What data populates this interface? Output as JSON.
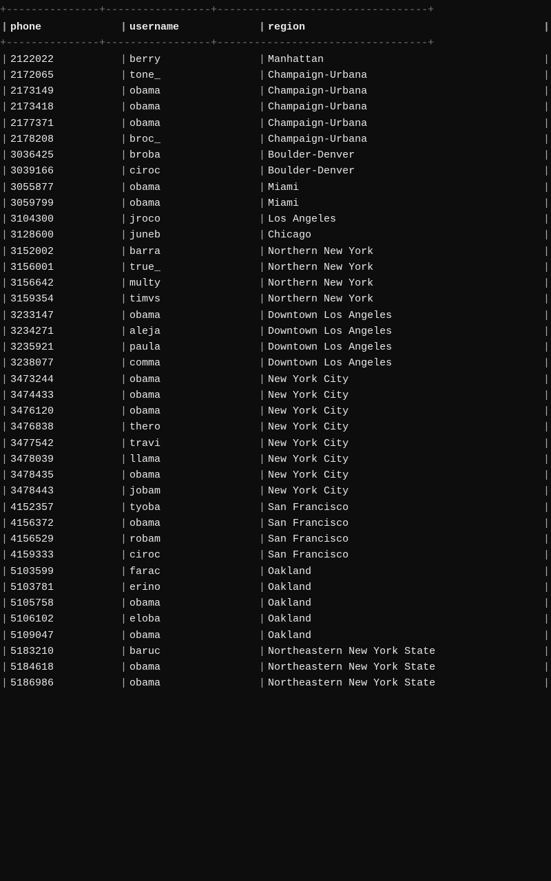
{
  "table": {
    "border_top": "+--------------+--------------+----------------------------------+",
    "border_mid": "+--------------+--------------+----------------------------------+",
    "headers": {
      "phone": "phone",
      "username": "username",
      "region": "region"
    },
    "rows": [
      {
        "phone": "2122022",
        "phone_blur": "    ",
        "username": "berry",
        "username_blur": "          ",
        "region": "Manhattan"
      },
      {
        "phone": "2172065",
        "phone_blur": "    ",
        "username": "tone_",
        "username_blur": "         ",
        "region": "Champaign-Urbana"
      },
      {
        "phone": "2173149",
        "phone_blur": "    ",
        "username": "obama",
        "username_blur": "         ",
        "region": "Champaign-Urbana"
      },
      {
        "phone": "2173418",
        "phone_blur": "    ",
        "username": "obama",
        "username_blur": "         ",
        "region": "Champaign-Urbana"
      },
      {
        "phone": "2177371",
        "phone_blur": "    ",
        "username": "obama",
        "username_blur": "              ",
        "region": "Champaign-Urbana"
      },
      {
        "phone": "2178208",
        "phone_blur": "    ",
        "username": "broc_",
        "username_blur": "         ",
        "region": "Champaign-Urbana"
      },
      {
        "phone": "3036425",
        "phone_blur": "    ",
        "username": "broba",
        "username_blur": "         ",
        "region": "Boulder-Denver"
      },
      {
        "phone": "3039166",
        "phone_blur": "    ",
        "username": "ciroc",
        "username_blur": "         ",
        "region": "Boulder-Denver"
      },
      {
        "phone": "3055877",
        "phone_blur": "    ",
        "username": "obama",
        "username_blur": "         ",
        "region": "Miami"
      },
      {
        "phone": "3059799",
        "phone_blur": "    ",
        "username": "obama",
        "username_blur": "         ",
        "region": "Miami"
      },
      {
        "phone": "3104300",
        "phone_blur": "    ",
        "username": "jroco",
        "username_blur": "         ",
        "region": "Los Angeles"
      },
      {
        "phone": "3128600",
        "phone_blur": "    ",
        "username": "juneb",
        "username_blur": "         ",
        "region": "Chicago"
      },
      {
        "phone": "3152002",
        "phone_blur": "    ",
        "username": "barra",
        "username_blur": "         ",
        "region": "Northern New York"
      },
      {
        "phone": "3156001",
        "phone_blur": "    ",
        "username": "true_",
        "username_blur": "         ",
        "region": "Northern New York"
      },
      {
        "phone": "3156642",
        "phone_blur": "    ",
        "username": "multy",
        "username_blur": "              ",
        "region": "Northern New York"
      },
      {
        "phone": "3159354",
        "phone_blur": "    ",
        "username": "timvs",
        "username_blur": "         ",
        "region": "Northern New York"
      },
      {
        "phone": "3233147",
        "phone_blur": "    ",
        "username": "obama",
        "username_blur": "         ",
        "region": "Downtown Los Angeles"
      },
      {
        "phone": "3234271",
        "phone_blur": "    ",
        "username": "aleja",
        "username_blur": "         ",
        "region": "Downtown Los Angeles"
      },
      {
        "phone": "3235921",
        "phone_blur": "    ",
        "username": "paula",
        "username_blur": "         ",
        "region": "Downtown Los Angeles"
      },
      {
        "phone": "3238077",
        "phone_blur": "    ",
        "username": "comma",
        "username_blur": "              ",
        "region": "Downtown Los Angeles"
      },
      {
        "phone": "3473244",
        "phone_blur": "    ",
        "username": "obama",
        "username_blur": "        ",
        "region": "New York City"
      },
      {
        "phone": "3474433",
        "phone_blur": "    ",
        "username": "obama",
        "username_blur": "         ",
        "region": "New York City"
      },
      {
        "phone": "3476120",
        "phone_blur": "    ",
        "username": "obama",
        "username_blur": "         ",
        "region": "New York City"
      },
      {
        "phone": "3476838",
        "phone_blur": "    ",
        "username": "thero",
        "username_blur": "         ",
        "region": "New York City"
      },
      {
        "phone": "3477542",
        "phone_blur": "    ",
        "username": "travi",
        "username_blur": "         ",
        "region": "New York City"
      },
      {
        "phone": "3478039",
        "phone_blur": "    ",
        "username": "llama",
        "username_blur": "         ",
        "region": "New York City"
      },
      {
        "phone": "3478435",
        "phone_blur": "    ",
        "username": "obama",
        "username_blur": "              ",
        "region": "New York City"
      },
      {
        "phone": "3478443",
        "phone_blur": "    ",
        "username": "jobam",
        "username_blur": "         ",
        "region": "New York City"
      },
      {
        "phone": "4152357",
        "phone_blur": "    ",
        "username": "tyoba",
        "username_blur": "         ",
        "region": "San Francisco"
      },
      {
        "phone": "4156372",
        "phone_blur": "    ",
        "username": "obama",
        "username_blur": "              ",
        "region": "San Francisco"
      },
      {
        "phone": "4156529",
        "phone_blur": "    ",
        "username": "robam",
        "username_blur": "         ",
        "region": "San Francisco"
      },
      {
        "phone": "4159333",
        "phone_blur": "    ",
        "username": "ciroc",
        "username_blur": "         ",
        "region": "San Francisco"
      },
      {
        "phone": "5103599",
        "phone_blur": "    ",
        "username": "farac",
        "username_blur": "         ",
        "region": "Oakland"
      },
      {
        "phone": "5103781",
        "phone_blur": "    ",
        "username": "erino",
        "username_blur": "         ",
        "region": "Oakland"
      },
      {
        "phone": "5105758",
        "phone_blur": "    ",
        "username": "obama",
        "username_blur": "         ",
        "region": "Oakland"
      },
      {
        "phone": "5106102",
        "phone_blur": "    ",
        "username": "eloba",
        "username_blur": "         ",
        "region": "Oakland"
      },
      {
        "phone": "5109047",
        "phone_blur": "    ",
        "username": "obama",
        "username_blur": "         ",
        "region": "Oakland"
      },
      {
        "phone": "5183210",
        "phone_blur": "    ",
        "username": "baruc",
        "username_blur": "         ",
        "region": "Northeastern New York State"
      },
      {
        "phone": "5184618",
        "phone_blur": "    ",
        "username": "obama",
        "username_blur": "         ",
        "region": "Northeastern New York State"
      },
      {
        "phone": "5186986",
        "phone_blur": "    ",
        "username": "obama",
        "username_blur": "         ",
        "region": "Northeastern New York State"
      }
    ]
  }
}
